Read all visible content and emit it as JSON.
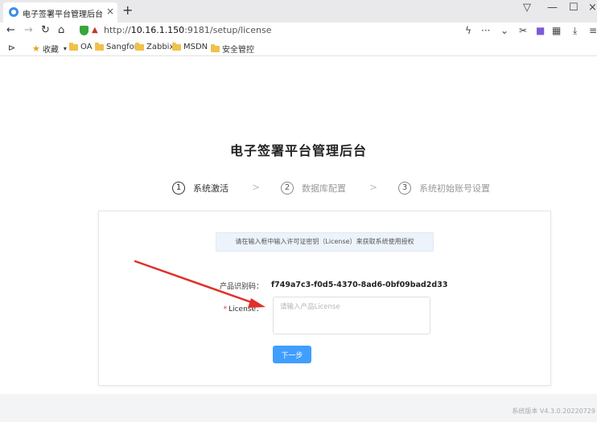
{
  "browser": {
    "tab_title": "电子签署平台管理后台",
    "tab_close": "×",
    "new_tab": "+",
    "url_prefix": "http://",
    "url_host": "10.16.1.150",
    "url_rest": ":9181/setup/license",
    "bookmarks": {
      "favorites": "收藏",
      "items": [
        "OA",
        "Sangfor",
        "Zabbix",
        "MSDN",
        "安全管控"
      ]
    },
    "accent_color": "#409eff"
  },
  "page": {
    "title": "电子签署平台管理后台",
    "steps": [
      {
        "num": "1",
        "label": "系统激活",
        "active": true
      },
      {
        "num": "2",
        "label": "数据库配置",
        "active": false
      },
      {
        "num": "3",
        "label": "系统初始账号设置",
        "active": false
      }
    ],
    "step_separator": ">",
    "notice": "请在输入框中输入许可证密钥（License）来获取系统使用授权",
    "product_id_label": "产品识别码：",
    "product_id_value": "f749a7c3-f0d5-4370-8ad6-0bf09bad2d33",
    "license_required_mark": "*",
    "license_label": "License：",
    "license_placeholder": "请输入产品License",
    "license_value": "",
    "next_button": "下一步",
    "version": "系统版本 V4.3.0.20220729"
  }
}
